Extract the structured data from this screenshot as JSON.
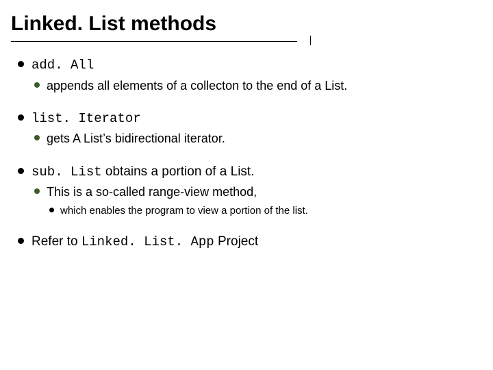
{
  "title": "Linked. List methods",
  "items": [
    {
      "head_code": "add. All",
      "sub": [
        {
          "text": "appends all elements of a collecton to the end of a List."
        }
      ]
    },
    {
      "head_code": "list. Iterator",
      "sub": [
        {
          "text": "gets A List’s bidirectional iterator."
        }
      ]
    },
    {
      "head_code": "sub. List",
      "head_text_after": " obtains a portion of a List.",
      "sub": [
        {
          "text": "This is a so-called range-view method,",
          "sub": [
            {
              "text": "which enables the program to view a portion of the list."
            }
          ]
        }
      ]
    },
    {
      "head_text_before": "Refer to ",
      "head_code": "Linked. List. App",
      "head_text_after": " Project"
    }
  ]
}
